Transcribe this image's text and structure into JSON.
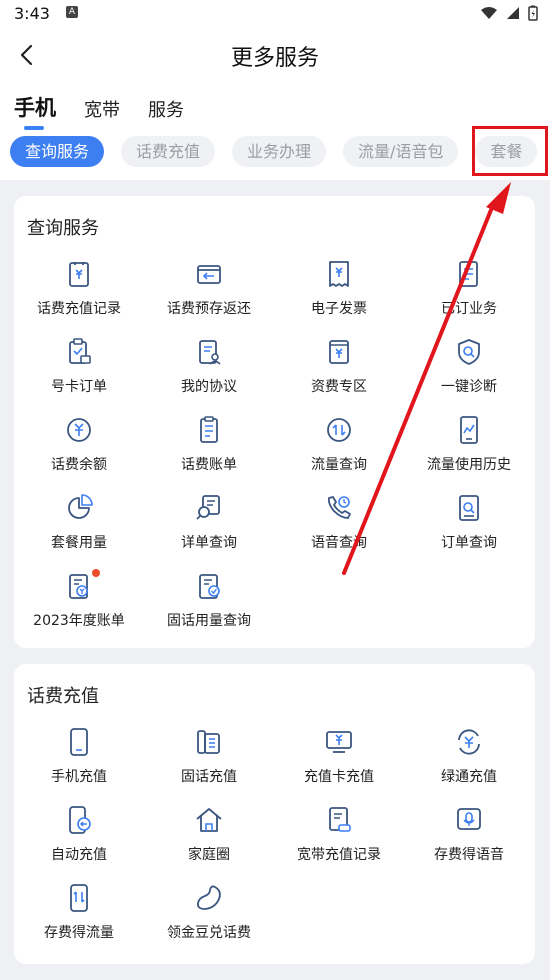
{
  "status": {
    "time": "3:43",
    "badge": "A"
  },
  "header": {
    "title": "更多服务"
  },
  "top_tabs": [
    "手机",
    "宽带",
    "服务"
  ],
  "chips": [
    "查询服务",
    "话费充值",
    "业务办理",
    "流量/语音包",
    "套餐"
  ],
  "section1": {
    "title": "查询服务",
    "items": [
      "话费充值记录",
      "话费预存返还",
      "电子发票",
      "已订业务",
      "号卡订单",
      "我的协议",
      "资费专区",
      "一键诊断",
      "话费余额",
      "话费账单",
      "流量查询",
      "流量使用历史",
      "套餐用量",
      "详单查询",
      "语音查询",
      "订单查询",
      "2023年度账单",
      "固话用量查询"
    ]
  },
  "section2": {
    "title": "话费充值",
    "items": [
      "手机充值",
      "固话充值",
      "充值卡充值",
      "绿通充值",
      "自动充值",
      "家庭圈",
      "宽带充值记录",
      "存费得语音",
      "存费得流量",
      "领金豆兑话费"
    ]
  },
  "colors": {
    "accent": "#3d7ff2",
    "icon": "#3a5680",
    "highlight": "#e0161c"
  }
}
